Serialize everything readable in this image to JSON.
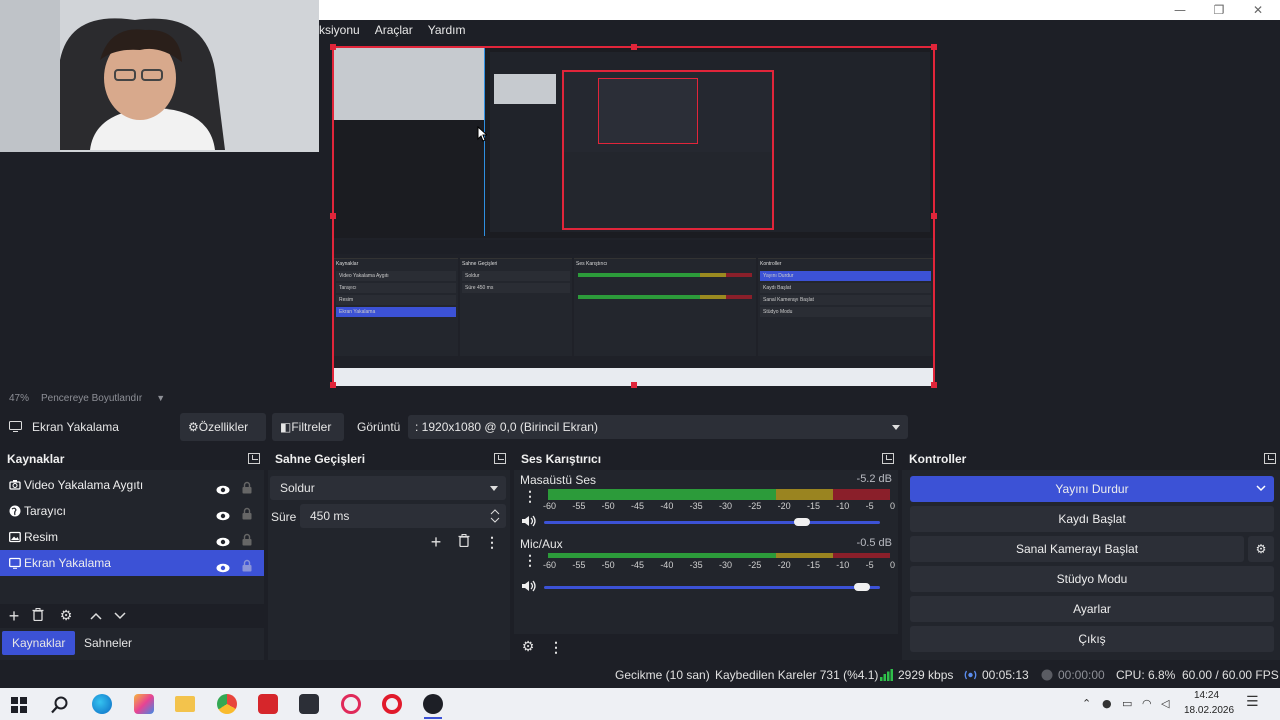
{
  "window": {
    "minimize_glyph": "—",
    "maximize_glyph": "❐",
    "close_glyph": "✕"
  },
  "menu": {
    "items": [
      "ksiyonu",
      "Araçlar",
      "Yardım"
    ]
  },
  "preview_zoom": {
    "percent": "47%",
    "mode": "Pencereye Boyutlandır"
  },
  "source_bar": {
    "source_name": "Ekran Yakalama",
    "properties_label": "Özellikler",
    "filters_label": "Filtreler",
    "display_label": "Görüntü",
    "display_value": ": 1920x1080 @ 0,0 (Birincil Ekran)"
  },
  "sources_dock": {
    "title": "Kaynaklar",
    "items": [
      {
        "label": "Video Yakalama Aygıtı",
        "icon": "camera-icon"
      },
      {
        "label": "Tarayıcı",
        "icon": "globe-icon"
      },
      {
        "label": "Resim",
        "icon": "image-icon"
      },
      {
        "label": "Ekran Yakalama",
        "icon": "monitor-icon",
        "selected": true
      }
    ]
  },
  "transitions_dock": {
    "title": "Sahne Geçişleri",
    "transition": "Soldur",
    "duration_label": "Süre",
    "duration_value": "450 ms"
  },
  "mixer_dock": {
    "title": "Ses Karıştırıcı",
    "channels": [
      {
        "name": "Masaüstü Ses",
        "db": "-5.2 dB",
        "volume_fraction": 0.78
      },
      {
        "name": "Mic/Aux",
        "db": "-0.5 dB",
        "volume_fraction": 0.97
      }
    ],
    "ticks": [
      "-60",
      "-55",
      "-50",
      "-45",
      "-40",
      "-35",
      "-30",
      "-25",
      "-20",
      "-15",
      "-10",
      "-5",
      "0"
    ]
  },
  "controls_dock": {
    "title": "Kontroller",
    "buttons": {
      "stop_stream": "Yayını Durdur",
      "start_record": "Kaydı Başlat",
      "virtual_cam": "Sanal Kamerayı Başlat",
      "studio_mode": "Stüdyo Modu",
      "settings": "Ayarlar",
      "exit": "Çıkış"
    }
  },
  "tabs": {
    "sources": "Kaynaklar",
    "scenes": "Sahneler"
  },
  "status": {
    "delay": "Gecikme (10 san)",
    "dropped": "Kaybedilen Kareler 731 (%4.1)",
    "bitrate": "2929 kbps",
    "stream_time": "00:05:13",
    "record_time": "00:00:00",
    "cpu": "CPU: 6.8%",
    "fps": "60.00 / 60.00 FPS"
  },
  "taskbar": {
    "time": "14:24",
    "date": "18.02.2026"
  },
  "colors": {
    "accent": "#3c52d6",
    "bg": "#1d1f26",
    "panel": "#22252c",
    "selection_red": "#e1253a"
  }
}
